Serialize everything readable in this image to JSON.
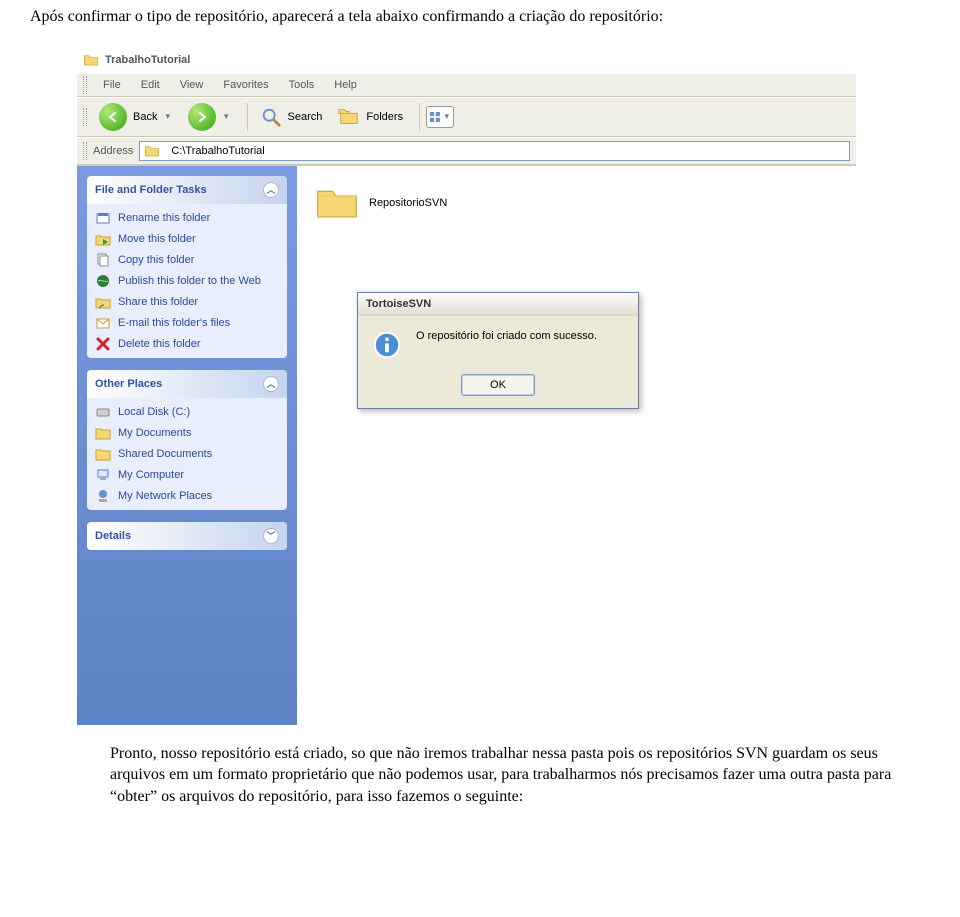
{
  "intro_text": "Após confirmar o tipo de repositório, aparecerá a tela abaixo confirmando a criação do repositório:",
  "body_text": "Pronto, nosso repositório está criado, so que não iremos trabalhar nessa pasta pois os repositórios SVN guardam os seus arquivos em um formato proprietário que não podemos usar, para trabalharmos nós precisamos fazer uma outra pasta para “obter” os arquivos do repositório, para isso fazemos o seguinte:",
  "explorer": {
    "title": "TrabalhoTutorial",
    "menus": [
      "File",
      "Edit",
      "View",
      "Favorites",
      "Tools",
      "Help"
    ],
    "toolbar": {
      "back": "Back",
      "search": "Search",
      "folders": "Folders"
    },
    "address_label": "Address",
    "address_path": "C:\\TrabalhoTutorial",
    "folder_item": "RepositorioSVN",
    "panels": {
      "tasks": {
        "title": "File and Folder Tasks",
        "items": [
          "Rename this folder",
          "Move this folder",
          "Copy this folder",
          "Publish this folder to the Web",
          "Share this folder",
          "E-mail this folder's files",
          "Delete this folder"
        ]
      },
      "places": {
        "title": "Other Places",
        "items": [
          "Local Disk (C:)",
          "My Documents",
          "Shared Documents",
          "My Computer",
          "My Network Places"
        ]
      },
      "details": {
        "title": "Details"
      }
    }
  },
  "dialog": {
    "title": "TortoiseSVN",
    "message": "O repositório foi criado com sucesso.",
    "ok": "OK"
  }
}
